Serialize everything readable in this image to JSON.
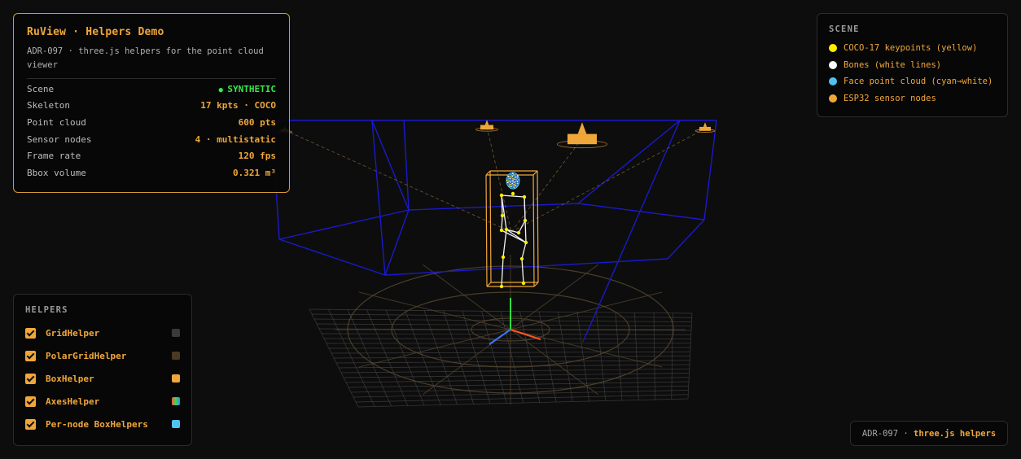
{
  "info": {
    "title": "RuView · Helpers Demo",
    "subtitle": "ADR-097 · three.js helpers for the point cloud viewer",
    "rows": [
      {
        "label": "Scene",
        "value": "SYNTHETIC"
      },
      {
        "label": "Skeleton",
        "value": "17 kpts · COCO"
      },
      {
        "label": "Point cloud",
        "value": "600 pts"
      },
      {
        "label": "Sensor nodes",
        "value": "4 · multistatic"
      },
      {
        "label": "Frame rate",
        "value": "120 fps"
      },
      {
        "label": "Bbox volume",
        "value": "0.321 m³"
      }
    ],
    "status_color": "#38e84a"
  },
  "scene_legend": {
    "title": "SCENE",
    "items": [
      {
        "label": "COCO-17 keypoints (yellow)",
        "color": "#ffee00"
      },
      {
        "label": "Bones (white lines)",
        "color": "#ffffff"
      },
      {
        "label": "Face point cloud (cyan→white)",
        "color": "#4ec3f0"
      },
      {
        "label": "ESP32 sensor nodes",
        "color": "#f0a73a"
      }
    ]
  },
  "helpers": {
    "title": "HELPERS",
    "items": [
      {
        "label": "GridHelper",
        "checked": true,
        "swatch": "#3a3a3a"
      },
      {
        "label": "PolarGridHelper",
        "checked": true,
        "swatch": "#4a3a22"
      },
      {
        "label": "BoxHelper",
        "checked": true,
        "swatch": "#f0a73a"
      },
      {
        "label": "AxesHelper",
        "checked": true,
        "swatch": "gradient"
      },
      {
        "label": "Per-node BoxHelpers",
        "checked": true,
        "swatch": "#4ec3f0"
      }
    ]
  },
  "footer": {
    "prefix": "ADR-097 · ",
    "accent": "three.js helpers"
  },
  "colors": {
    "accent": "#f0a73a",
    "room_box": "#1a1acc",
    "grid": "#5a4a30"
  }
}
